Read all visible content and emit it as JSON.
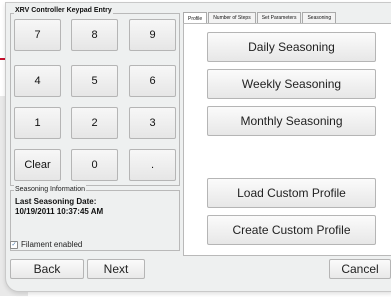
{
  "keypad": {
    "title": "XRV Controller Keypad Entry",
    "keys": [
      "7",
      "8",
      "9",
      "4",
      "5",
      "6",
      "1",
      "2",
      "3",
      "Clear",
      "0",
      "."
    ]
  },
  "seasoning_info": {
    "title": "Seasoning Information",
    "last_label": "Last Seasoning Date:",
    "last_date": "10/19/2011 10:37:45 AM"
  },
  "filament": {
    "checked": true,
    "label": "Filament enabled"
  },
  "footer": {
    "back_label": "Back",
    "next_label": "Next",
    "cancel_label": "Cancel"
  },
  "tabs": [
    {
      "label": "Profile",
      "active": true
    },
    {
      "label": "Number of Steps",
      "active": false
    },
    {
      "label": "Set Parameters",
      "active": false
    },
    {
      "label": "Seasoning",
      "active": false
    }
  ],
  "profile": {
    "daily_label": "Daily Seasoning",
    "weekly_label": "Weekly Seasoning",
    "monthly_label": "Monthly Seasoning",
    "load_label": "Load Custom Profile",
    "create_label": "Create Custom Profile"
  },
  "colors": {
    "accent_line": "#c8102e",
    "window_bg": "#eef0f0"
  }
}
